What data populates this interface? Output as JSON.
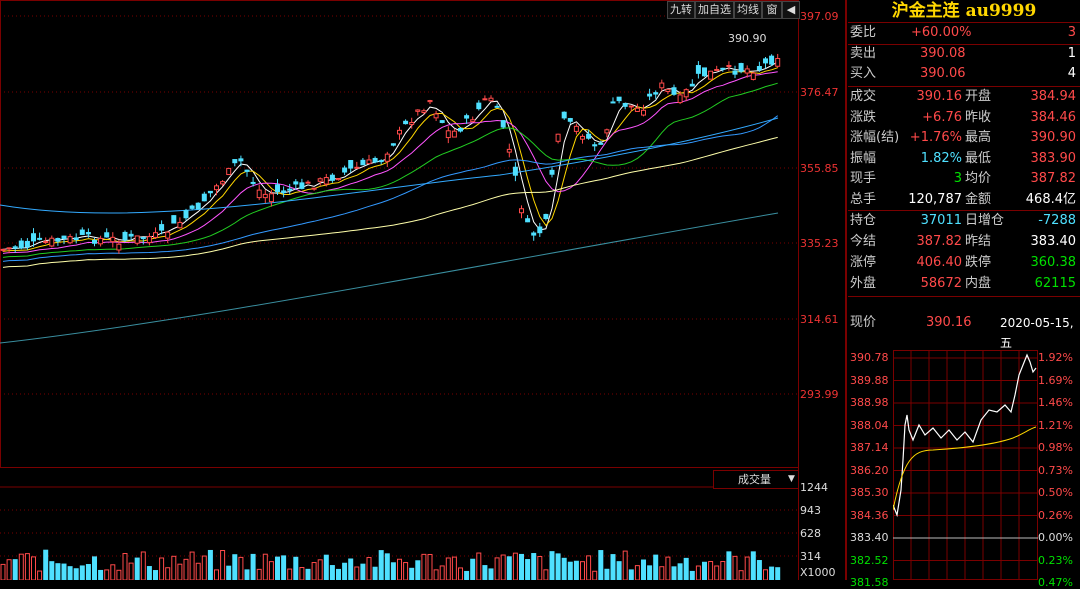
{
  "toolbar": {
    "b1": "九转",
    "b2": "加自选",
    "b3": "均线",
    "b4": "窗",
    "b5": "◆"
  },
  "yaxis": [
    "397.09",
    "376.47",
    "355.85",
    "335.23",
    "314.61",
    "293.99"
  ],
  "price_marker": "390.90",
  "volume": {
    "button": "成交量",
    "button_arrow": "▼",
    "yaxis": [
      "1244",
      "943",
      "628",
      "314",
      "X1000"
    ]
  },
  "panel": {
    "title": "沪金主连 au9999",
    "weibi": {
      "label": "委比",
      "value": "+60.00%",
      "count": "3"
    },
    "sell": {
      "label": "卖出",
      "value": "390.08",
      "count": "1"
    },
    "buy": {
      "label": "买入",
      "value": "390.06",
      "count": "4"
    },
    "rows": [
      {
        "l1": "成交",
        "v1": "390.16",
        "l2": "开盘",
        "v2": "384.94"
      },
      {
        "l1": "涨跌",
        "v1": "+6.76",
        "l2": "昨收",
        "v2": "384.46"
      },
      {
        "l1": "涨幅(结)",
        "v1": "+1.76%",
        "l2": "最高",
        "v2": "390.90"
      },
      {
        "l1": "振幅",
        "v1": "1.82%",
        "l2": "最低",
        "v2": "383.90"
      },
      {
        "l1": "现手",
        "v1": "3",
        "l2": "均价",
        "v2": "387.82"
      },
      {
        "l1": "总手",
        "v1": "120,787",
        "l2": "金额",
        "v2": "468.4亿"
      }
    ],
    "rows2": [
      {
        "l1": "持仓",
        "v1": "37011",
        "l2": "日增仓",
        "v2": "-7288"
      },
      {
        "l1": "今结",
        "v1": "387.82",
        "l2": "昨结",
        "v2": "383.40"
      },
      {
        "l1": "涨停",
        "v1": "406.40",
        "l2": "跌停",
        "v2": "360.38"
      },
      {
        "l1": "外盘",
        "v1": "58672",
        "l2": "内盘",
        "v2": "62115"
      }
    ],
    "xianjia": {
      "label": "现价",
      "value": "390.16",
      "date": "2020-05-15,五"
    }
  },
  "mini": {
    "left": [
      "390.78",
      "389.88",
      "388.98",
      "388.04",
      "387.14",
      "386.20",
      "385.30",
      "384.36",
      "383.40",
      "382.52",
      "381.58"
    ],
    "right": [
      "1.92%",
      "1.69%",
      "1.46%",
      "1.21%",
      "0.98%",
      "0.73%",
      "0.50%",
      "0.26%",
      "0.00%",
      "0.23%",
      "0.47%"
    ]
  },
  "colors": {
    "up": "#ff4a4a",
    "down": "#4fe0ff",
    "grid": "#7a0000",
    "title": "#ffd700"
  }
}
